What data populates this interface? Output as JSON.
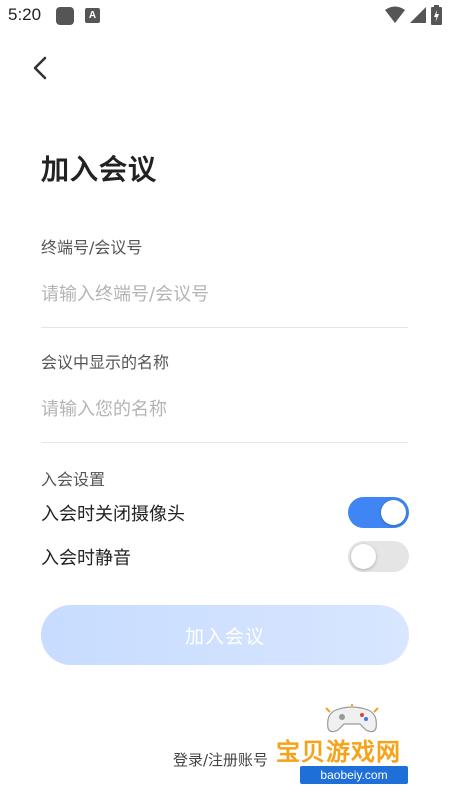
{
  "status_bar": {
    "time": "5:20",
    "app_icon_2_letter": "A"
  },
  "header": {
    "back_icon": "chevron-left-icon"
  },
  "page": {
    "title": "加入会议"
  },
  "form": {
    "meeting_id": {
      "label": "终端号/会议号",
      "placeholder": "请输入终端号/会议号",
      "value": ""
    },
    "display_name": {
      "label": "会议中显示的名称",
      "placeholder": "请输入您的名称",
      "value": ""
    }
  },
  "settings": {
    "section_label": "入会设置",
    "camera_off": {
      "label": "入会时关闭摄像头",
      "enabled": true
    },
    "mute": {
      "label": "入会时静音",
      "enabled": false
    }
  },
  "actions": {
    "join_label": "加入会议",
    "login_register_label": "登录/注册账号"
  },
  "watermark": {
    "text": "宝贝游戏网",
    "url": "baobeiy.com"
  },
  "colors": {
    "toggle_on": "#3f86f4",
    "toggle_off": "#e5e5e5",
    "join_button": "#c7dcff"
  }
}
